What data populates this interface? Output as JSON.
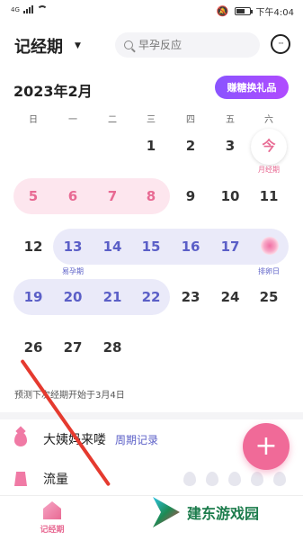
{
  "status_bar": {
    "network": "4G",
    "time": "下午4:04"
  },
  "header": {
    "title": "记经期",
    "search_placeholder": "早孕反应"
  },
  "calendar": {
    "month": "2023年2月",
    "gift_button": "赚糖换礼品",
    "weekdays": [
      "日",
      "一",
      "二",
      "三",
      "四",
      "五",
      "六"
    ],
    "today_label": "今",
    "period_start_label": "月经期",
    "fertile_label": "易孕期",
    "ovulation_label": "排卵日",
    "rows": [
      [
        {
          "d": "",
          "t": ""
        },
        {
          "d": "",
          "t": ""
        },
        {
          "d": "",
          "t": ""
        },
        {
          "d": "1",
          "t": "normal"
        },
        {
          "d": "2",
          "t": "normal"
        },
        {
          "d": "3",
          "t": "normal"
        },
        {
          "d": "",
          "t": "today"
        }
      ],
      [
        {
          "d": "5",
          "t": "period"
        },
        {
          "d": "6",
          "t": "period"
        },
        {
          "d": "7",
          "t": "period"
        },
        {
          "d": "8",
          "t": "period"
        },
        {
          "d": "9",
          "t": "normal"
        },
        {
          "d": "10",
          "t": "normal"
        },
        {
          "d": "11",
          "t": "normal"
        }
      ],
      [
        {
          "d": "12",
          "t": "normal"
        },
        {
          "d": "13",
          "t": "fertile"
        },
        {
          "d": "14",
          "t": "fertile"
        },
        {
          "d": "15",
          "t": "fertile"
        },
        {
          "d": "16",
          "t": "fertile"
        },
        {
          "d": "17",
          "t": "fertile"
        },
        {
          "d": "",
          "t": "ovulation"
        }
      ],
      [
        {
          "d": "19",
          "t": "fertile"
        },
        {
          "d": "20",
          "t": "fertile"
        },
        {
          "d": "21",
          "t": "fertile"
        },
        {
          "d": "22",
          "t": "fertile"
        },
        {
          "d": "23",
          "t": "normal"
        },
        {
          "d": "24",
          "t": "normal"
        },
        {
          "d": "25",
          "t": "normal"
        }
      ],
      [
        {
          "d": "26",
          "t": "normal"
        },
        {
          "d": "27",
          "t": "normal"
        },
        {
          "d": "28",
          "t": "normal"
        },
        {
          "d": "",
          "t": ""
        },
        {
          "d": "",
          "t": ""
        },
        {
          "d": "",
          "t": ""
        },
        {
          "d": "",
          "t": ""
        }
      ]
    ]
  },
  "prediction": "预测下次经期开始于3月4日",
  "records": {
    "period_label": "大姨妈来喽",
    "period_record": "周期记录",
    "flow_label": "流量",
    "flow_level": 0
  },
  "fab": "+",
  "tabbar": {
    "home": "记经期"
  },
  "watermark": "建东游戏园",
  "colors": {
    "pink": "#e86a93",
    "fertile_blue": "#5b5fc7",
    "accent_purple": "#8a54ff",
    "fab": "#f06a98"
  }
}
